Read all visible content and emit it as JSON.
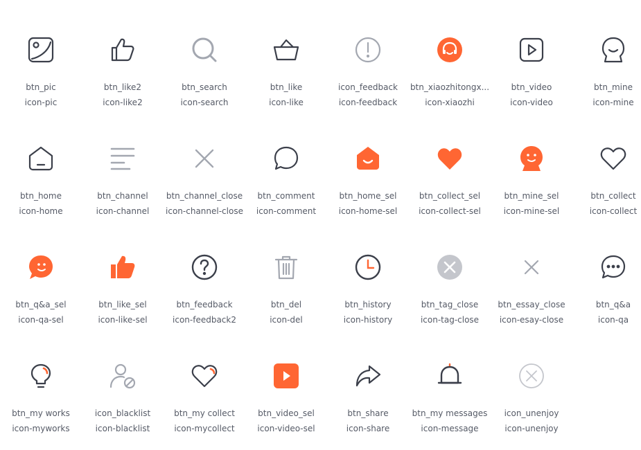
{
  "colors": {
    "text": "#555a66",
    "dark": "#3b3f4a",
    "gray": "#a3a7b0",
    "accent": "#ff6633",
    "tag_close_bg": "#c4c6cc"
  },
  "icons": [
    {
      "icon": "pic-icon",
      "name": "btn_pic",
      "class": "icon-pic"
    },
    {
      "icon": "thumbs-up-outline-icon",
      "name": "btn_like2",
      "class": "icon-like2"
    },
    {
      "icon": "search-icon",
      "name": "btn_search",
      "class": "icon-search"
    },
    {
      "icon": "basket-icon",
      "name": "btn_like",
      "class": "icon-like"
    },
    {
      "icon": "exclamation-circle-icon",
      "name": "icon_feedback",
      "class": "icon-feedback"
    },
    {
      "icon": "headset-icon",
      "name": "btn_xiaozhitongx...",
      "class": "icon-xiaozhi"
    },
    {
      "icon": "video-play-icon",
      "name": "btn_video",
      "class": "icon-video"
    },
    {
      "icon": "mine-face-icon",
      "name": "btn_mine",
      "class": "icon-mine"
    },
    {
      "icon": "home-icon",
      "name": "btn_home",
      "class": "icon-home"
    },
    {
      "icon": "channel-lines-icon",
      "name": "btn_channel",
      "class": "icon-channel"
    },
    {
      "icon": "close-x-icon",
      "name": "btn_channel_close",
      "class": "icon-channel-close"
    },
    {
      "icon": "comment-bubble-icon",
      "name": "btn_comment",
      "class": "icon-comment"
    },
    {
      "icon": "home-filled-icon",
      "name": "btn_home_sel",
      "class": "icon-home-sel"
    },
    {
      "icon": "heart-filled-icon",
      "name": "btn_collect_sel",
      "class": "icon-collect-sel"
    },
    {
      "icon": "mine-filled-icon",
      "name": "btn_mine_sel",
      "class": "icon-mine-sel"
    },
    {
      "icon": "heart-outline-icon",
      "name": "btn_collect",
      "class": "icon-collect"
    },
    {
      "icon": "qa-filled-icon",
      "name": "btn_q&a_sel",
      "class": "icon-qa-sel"
    },
    {
      "icon": "thumbs-up-filled-icon",
      "name": "btn_like_sel",
      "class": "icon-like-sel"
    },
    {
      "icon": "question-circle-icon",
      "name": "btn_feedback",
      "class": "icon-feedback2"
    },
    {
      "icon": "trash-icon",
      "name": "btn_del",
      "class": "icon-del"
    },
    {
      "icon": "clock-icon",
      "name": "btn_history",
      "class": "icon-history"
    },
    {
      "icon": "tag-close-circle-icon",
      "name": "btn_tag_close",
      "class": "icon-tag-close"
    },
    {
      "icon": "essay-close-x-icon",
      "name": "btn_essay_close",
      "class": "icon-esay-close"
    },
    {
      "icon": "qa-dots-bubble-icon",
      "name": "btn_q&a",
      "class": "icon-qa"
    },
    {
      "icon": "lightbulb-icon",
      "name": "btn_my works",
      "class": "icon-myworks"
    },
    {
      "icon": "user-blocked-icon",
      "name": "icon_blacklist",
      "class": "icon-blacklist"
    },
    {
      "icon": "heart-outline-accent-icon",
      "name": "btn_my collect",
      "class": "icon-mycollect"
    },
    {
      "icon": "video-filled-icon",
      "name": "btn_video_sel",
      "class": "icon-video-sel"
    },
    {
      "icon": "share-arrow-icon",
      "name": "btn_share",
      "class": "icon-share"
    },
    {
      "icon": "bell-icon",
      "name": "btn_my messages",
      "class": "icon-message"
    },
    {
      "icon": "unenjoy-circle-x-icon",
      "name": "icon_unenjoy",
      "class": "icon-unenjoy"
    }
  ]
}
